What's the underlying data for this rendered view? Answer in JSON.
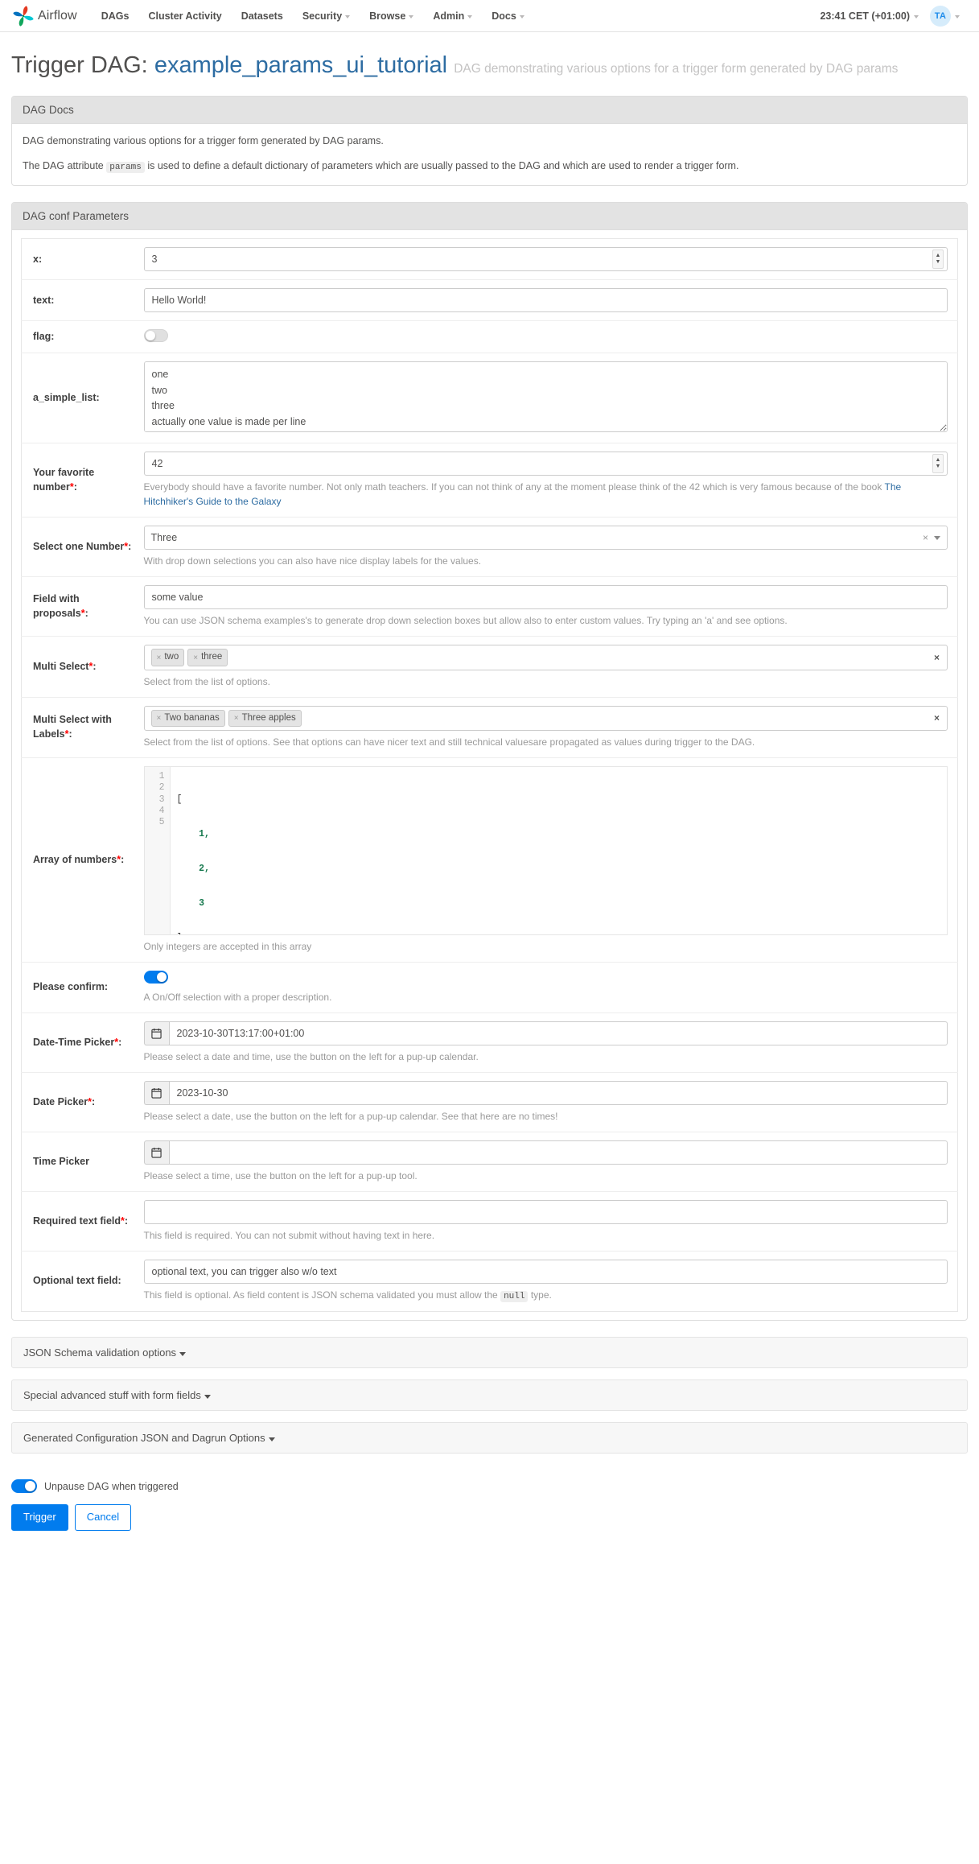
{
  "navbar": {
    "brand": "Airflow",
    "items": [
      {
        "label": "DAGs",
        "has_caret": false
      },
      {
        "label": "Cluster Activity",
        "has_caret": false
      },
      {
        "label": "Datasets",
        "has_caret": false
      },
      {
        "label": "Security",
        "has_caret": true
      },
      {
        "label": "Browse",
        "has_caret": true
      },
      {
        "label": "Admin",
        "has_caret": true
      },
      {
        "label": "Docs",
        "has_caret": true
      }
    ],
    "clock": "23:41 CET (+01:00)",
    "avatar_initials": "TA"
  },
  "page": {
    "title_prefix": "Trigger DAG:",
    "dag_name": "example_params_ui_tutorial",
    "dag_description": "DAG demonstrating various options for a trigger form generated by DAG params"
  },
  "dag_docs": {
    "header": "DAG Docs",
    "paragraph1": "DAG demonstrating various options for a trigger form generated by DAG params.",
    "paragraph2_before": "The DAG attribute",
    "paragraph2_code": "params",
    "paragraph2_after": "is used to define a default dictionary of parameters which are usually passed to the DAG and which are used to render a trigger form."
  },
  "conf": {
    "header": "DAG conf Parameters",
    "fields": {
      "x": {
        "label": "x:",
        "value": "3"
      },
      "text": {
        "label": "text:",
        "value": "Hello World!"
      },
      "flag": {
        "label": "flag:",
        "state": "off"
      },
      "a_simple_list": {
        "label": "a_simple_list:",
        "value": "one\ntwo\nthree\nactually one value is made per line"
      },
      "favorite_number": {
        "label": "Your favorite number",
        "required": true,
        "value": "42",
        "help_before": "Everybody should have a favorite number. Not only math teachers. If you can not think of any at the moment please think of the 42 which is very famous because of the book ",
        "help_link": "The Hitchhiker's Guide to the Galaxy"
      },
      "select_one_number": {
        "label": "Select one Number",
        "required": true,
        "value": "Three",
        "clear_glyph": "×",
        "help": "With drop down selections you can also have nice display labels for the values."
      },
      "field_with_proposals": {
        "label": "Field with proposals",
        "required": true,
        "value": "some value",
        "help": "You can use JSON schema examples's to generate drop down selection boxes but allow also to enter custom values. Try typing an 'a' and see options."
      },
      "multi_select": {
        "label": "Multi Select",
        "required": true,
        "tags": [
          "two",
          "three"
        ],
        "help": "Select from the list of options."
      },
      "multi_select_labels": {
        "label": "Multi Select with Labels",
        "required": true,
        "tags": [
          "Two bananas",
          "Three apples"
        ],
        "help": "Select from the list of options. See that options can have nicer text and still technical valuesare propagated as values during trigger to the DAG."
      },
      "array_of_numbers": {
        "label": "Array of numbers",
        "required": true,
        "line_numbers": [
          "1",
          "2",
          "3",
          "4",
          "5"
        ],
        "code_lines": [
          "[",
          "    1,",
          "    2,",
          "    3",
          "]"
        ],
        "help": "Only integers are accepted in this array"
      },
      "please_confirm": {
        "label": "Please confirm:",
        "state": "on",
        "help": "A On/Off selection with a proper description."
      },
      "datetime_picker": {
        "label": "Date-Time Picker",
        "required": true,
        "value": "2023-10-30T13:17:00+01:00",
        "help": "Please select a date and time, use the button on the left for a pup-up calendar."
      },
      "date_picker": {
        "label": "Date Picker",
        "required": true,
        "value": "2023-10-30",
        "help": "Please select a date, use the button on the left for a pup-up calendar. See that here are no times!"
      },
      "time_picker": {
        "label": "Time Picker",
        "required": false,
        "value": "",
        "help": "Please select a time, use the button on the left for a pup-up tool."
      },
      "required_text": {
        "label": "Required text field",
        "required": true,
        "value": "",
        "help": "This field is required. You can not submit without having text in here."
      },
      "optional_text": {
        "label": "Optional text field:",
        "required": false,
        "value": "optional text, you can trigger also w/o text",
        "help_before": "This field is optional. As field content is JSON schema validated you must allow the",
        "help_code": "null",
        "help_after": "type."
      }
    }
  },
  "accordions": [
    {
      "label": "JSON Schema validation options"
    },
    {
      "label": "Special advanced stuff with form fields"
    },
    {
      "label": "Generated Configuration JSON and Dagrun Options"
    }
  ],
  "footer": {
    "unpause_label": "Unpause DAG when triggered",
    "unpause_state": "on",
    "trigger_label": "Trigger",
    "cancel_label": "Cancel"
  },
  "colors": {
    "accent": "#017cee",
    "link": "#2d6ca2",
    "required": "#ff0000",
    "panel_head": "#e3e3e3"
  }
}
